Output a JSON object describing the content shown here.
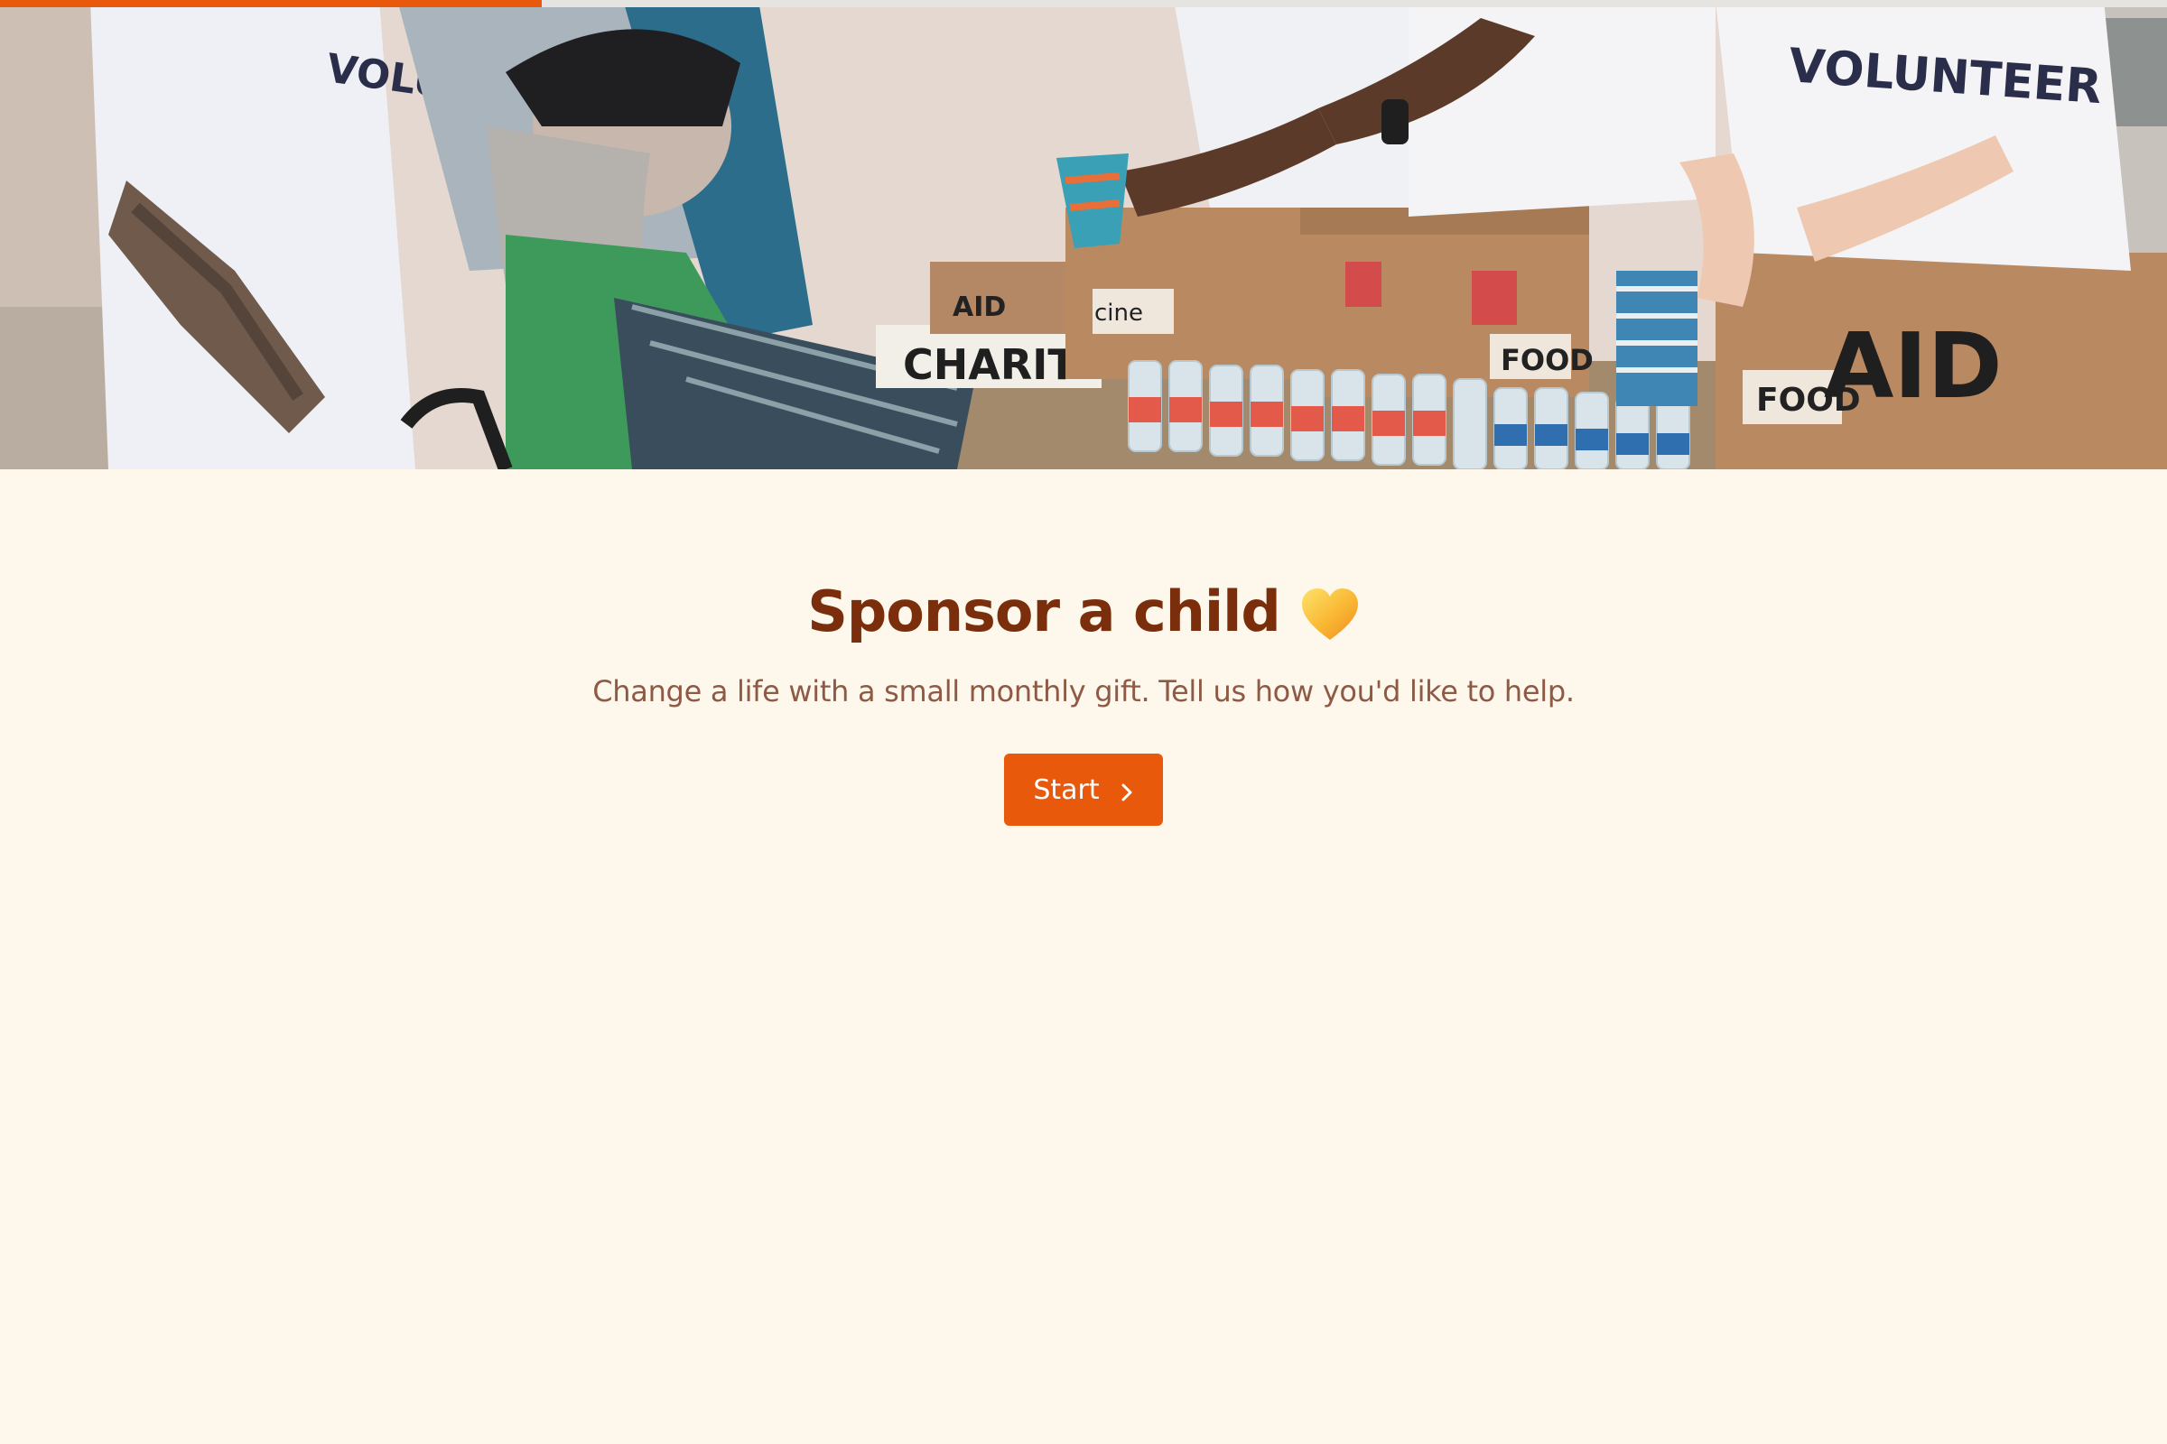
{
  "progress": {
    "fraction": 0.25,
    "color": "#e8590c"
  },
  "hero": {
    "image": "volunteers-handing-out-food-and-water-photo"
  },
  "main": {
    "title": "Sponsor a child",
    "title_icon": "yellow-heart-icon",
    "subtitle": "Change a life with a small monthly gift. Tell us how you'd like to help.",
    "start_label": "Start",
    "start_icon": "chevron-right-icon"
  },
  "colors": {
    "background": "#fdf7ec",
    "accent": "#e8590c",
    "title": "#7a2e0b",
    "subtitle": "#8f5a45"
  }
}
